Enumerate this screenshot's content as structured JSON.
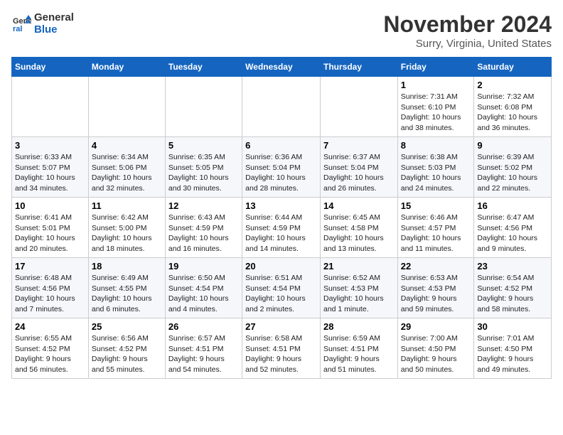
{
  "logo": {
    "line1": "General",
    "line2": "Blue"
  },
  "title": "November 2024",
  "subtitle": "Surry, Virginia, United States",
  "weekdays": [
    "Sunday",
    "Monday",
    "Tuesday",
    "Wednesday",
    "Thursday",
    "Friday",
    "Saturday"
  ],
  "weeks": [
    [
      {
        "day": "",
        "info": ""
      },
      {
        "day": "",
        "info": ""
      },
      {
        "day": "",
        "info": ""
      },
      {
        "day": "",
        "info": ""
      },
      {
        "day": "",
        "info": ""
      },
      {
        "day": "1",
        "info": "Sunrise: 7:31 AM\nSunset: 6:10 PM\nDaylight: 10 hours\nand 38 minutes."
      },
      {
        "day": "2",
        "info": "Sunrise: 7:32 AM\nSunset: 6:08 PM\nDaylight: 10 hours\nand 36 minutes."
      }
    ],
    [
      {
        "day": "3",
        "info": "Sunrise: 6:33 AM\nSunset: 5:07 PM\nDaylight: 10 hours\nand 34 minutes."
      },
      {
        "day": "4",
        "info": "Sunrise: 6:34 AM\nSunset: 5:06 PM\nDaylight: 10 hours\nand 32 minutes."
      },
      {
        "day": "5",
        "info": "Sunrise: 6:35 AM\nSunset: 5:05 PM\nDaylight: 10 hours\nand 30 minutes."
      },
      {
        "day": "6",
        "info": "Sunrise: 6:36 AM\nSunset: 5:04 PM\nDaylight: 10 hours\nand 28 minutes."
      },
      {
        "day": "7",
        "info": "Sunrise: 6:37 AM\nSunset: 5:04 PM\nDaylight: 10 hours\nand 26 minutes."
      },
      {
        "day": "8",
        "info": "Sunrise: 6:38 AM\nSunset: 5:03 PM\nDaylight: 10 hours\nand 24 minutes."
      },
      {
        "day": "9",
        "info": "Sunrise: 6:39 AM\nSunset: 5:02 PM\nDaylight: 10 hours\nand 22 minutes."
      }
    ],
    [
      {
        "day": "10",
        "info": "Sunrise: 6:41 AM\nSunset: 5:01 PM\nDaylight: 10 hours\nand 20 minutes."
      },
      {
        "day": "11",
        "info": "Sunrise: 6:42 AM\nSunset: 5:00 PM\nDaylight: 10 hours\nand 18 minutes."
      },
      {
        "day": "12",
        "info": "Sunrise: 6:43 AM\nSunset: 4:59 PM\nDaylight: 10 hours\nand 16 minutes."
      },
      {
        "day": "13",
        "info": "Sunrise: 6:44 AM\nSunset: 4:59 PM\nDaylight: 10 hours\nand 14 minutes."
      },
      {
        "day": "14",
        "info": "Sunrise: 6:45 AM\nSunset: 4:58 PM\nDaylight: 10 hours\nand 13 minutes."
      },
      {
        "day": "15",
        "info": "Sunrise: 6:46 AM\nSunset: 4:57 PM\nDaylight: 10 hours\nand 11 minutes."
      },
      {
        "day": "16",
        "info": "Sunrise: 6:47 AM\nSunset: 4:56 PM\nDaylight: 10 hours\nand 9 minutes."
      }
    ],
    [
      {
        "day": "17",
        "info": "Sunrise: 6:48 AM\nSunset: 4:56 PM\nDaylight: 10 hours\nand 7 minutes."
      },
      {
        "day": "18",
        "info": "Sunrise: 6:49 AM\nSunset: 4:55 PM\nDaylight: 10 hours\nand 6 minutes."
      },
      {
        "day": "19",
        "info": "Sunrise: 6:50 AM\nSunset: 4:54 PM\nDaylight: 10 hours\nand 4 minutes."
      },
      {
        "day": "20",
        "info": "Sunrise: 6:51 AM\nSunset: 4:54 PM\nDaylight: 10 hours\nand 2 minutes."
      },
      {
        "day": "21",
        "info": "Sunrise: 6:52 AM\nSunset: 4:53 PM\nDaylight: 10 hours\nand 1 minute."
      },
      {
        "day": "22",
        "info": "Sunrise: 6:53 AM\nSunset: 4:53 PM\nDaylight: 9 hours\nand 59 minutes."
      },
      {
        "day": "23",
        "info": "Sunrise: 6:54 AM\nSunset: 4:52 PM\nDaylight: 9 hours\nand 58 minutes."
      }
    ],
    [
      {
        "day": "24",
        "info": "Sunrise: 6:55 AM\nSunset: 4:52 PM\nDaylight: 9 hours\nand 56 minutes."
      },
      {
        "day": "25",
        "info": "Sunrise: 6:56 AM\nSunset: 4:52 PM\nDaylight: 9 hours\nand 55 minutes."
      },
      {
        "day": "26",
        "info": "Sunrise: 6:57 AM\nSunset: 4:51 PM\nDaylight: 9 hours\nand 54 minutes."
      },
      {
        "day": "27",
        "info": "Sunrise: 6:58 AM\nSunset: 4:51 PM\nDaylight: 9 hours\nand 52 minutes."
      },
      {
        "day": "28",
        "info": "Sunrise: 6:59 AM\nSunset: 4:51 PM\nDaylight: 9 hours\nand 51 minutes."
      },
      {
        "day": "29",
        "info": "Sunrise: 7:00 AM\nSunset: 4:50 PM\nDaylight: 9 hours\nand 50 minutes."
      },
      {
        "day": "30",
        "info": "Sunrise: 7:01 AM\nSunset: 4:50 PM\nDaylight: 9 hours\nand 49 minutes."
      }
    ]
  ]
}
